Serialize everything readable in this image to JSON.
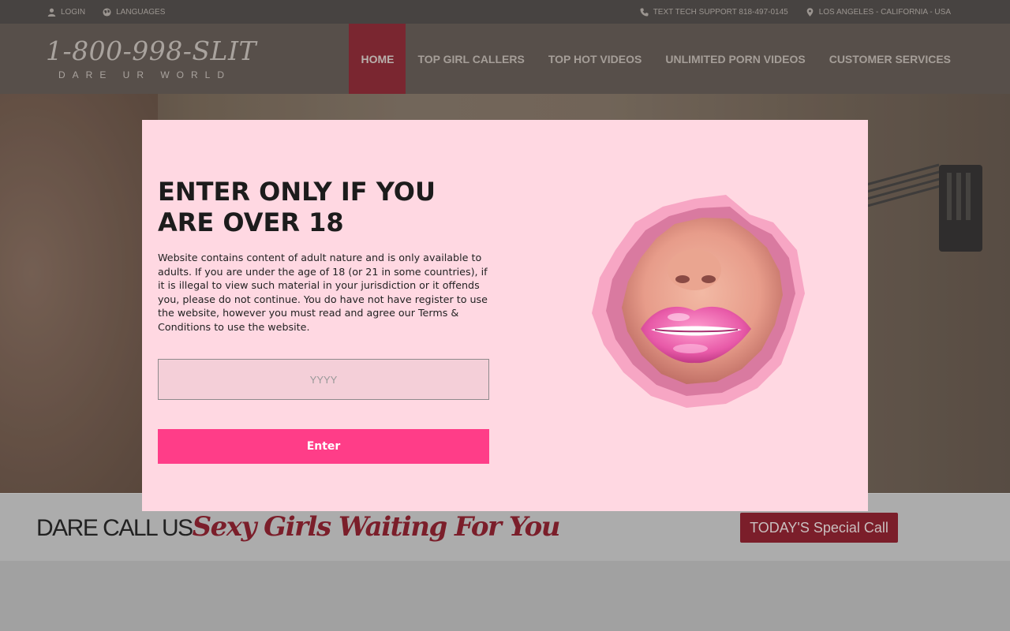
{
  "topbar": {
    "login": "LOGIN",
    "languages": "LANGUAGES",
    "support": "TEXT TECH SUPPORT 818-497-0145",
    "location": "LOS ANGELES - CALIFORNIA - USA"
  },
  "logo": {
    "phone": "1-800-998-SLIT",
    "tagline": "DARE UR WORLD"
  },
  "nav": {
    "items": [
      {
        "label": "HOME",
        "active": true
      },
      {
        "label": "TOP GIRL CALLERS"
      },
      {
        "label": "TOP HOT VIDEOS"
      },
      {
        "label": "UNLIMITED PORN VIDEOS"
      },
      {
        "label": "CUSTOMER SERVICES"
      }
    ]
  },
  "cta": {
    "plain": "DARE CALL US",
    "script": "Sexy Girls Waiting For You",
    "button": "TODAY'S Special Call"
  },
  "modal": {
    "title": "ENTER ONLY IF YOU ARE OVER 18",
    "body": "Website contains content of adult nature and is only available to adults. If you are under the age of 18 (or 21 in some countries), if it is illegal to view such material in your jurisdiction or it offends you, please do not continue. You do have not have register to use the website, however you must read and agree our Terms & Conditions to use the website.",
    "year_placeholder": "YYYY",
    "year_value": "",
    "enter_label": "Enter"
  },
  "colors": {
    "modal_bg": "#ffd8e2",
    "enter_button": "#ff3d88",
    "nav_active": "#7a2630",
    "brand_red": "#7b1e2a"
  }
}
